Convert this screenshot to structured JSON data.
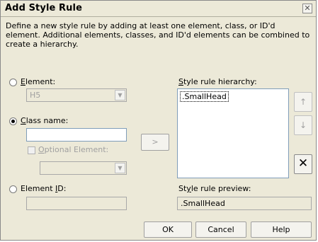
{
  "title": "Add Style Rule",
  "close_glyph": "✕",
  "description": "Define a new style rule by adding at least one element, class, or ID'd element. Additional elements, classes, and ID'd elements can be combined to create a hierarchy.",
  "element": {
    "label_first": "E",
    "label_rest": "lement:",
    "value": "H5",
    "selected": false
  },
  "class_name": {
    "label_first": "C",
    "label_rest": "lass name:",
    "value": "",
    "selected": true
  },
  "optional_element": {
    "label_first": "O",
    "label_rest": "ptional Element:",
    "value": "",
    "checked": false
  },
  "element_id": {
    "label_pre": "Element ",
    "label_first": "I",
    "label_rest": "D:",
    "value": "",
    "selected": false
  },
  "add_button": ">",
  "hierarchy": {
    "label_first": "S",
    "label_rest": "tyle rule hierarchy:",
    "items": [
      ".SmallHead"
    ]
  },
  "move_up_glyph": "↑",
  "move_down_glyph": "↓",
  "delete_glyph": "✕",
  "preview": {
    "label_pre": "St",
    "label_first": "y",
    "label_rest": "le rule preview:",
    "value": ".SmallHead"
  },
  "buttons": {
    "ok": "OK",
    "cancel": "Cancel",
    "help": "Help"
  },
  "dropdown_glyph": "▼"
}
